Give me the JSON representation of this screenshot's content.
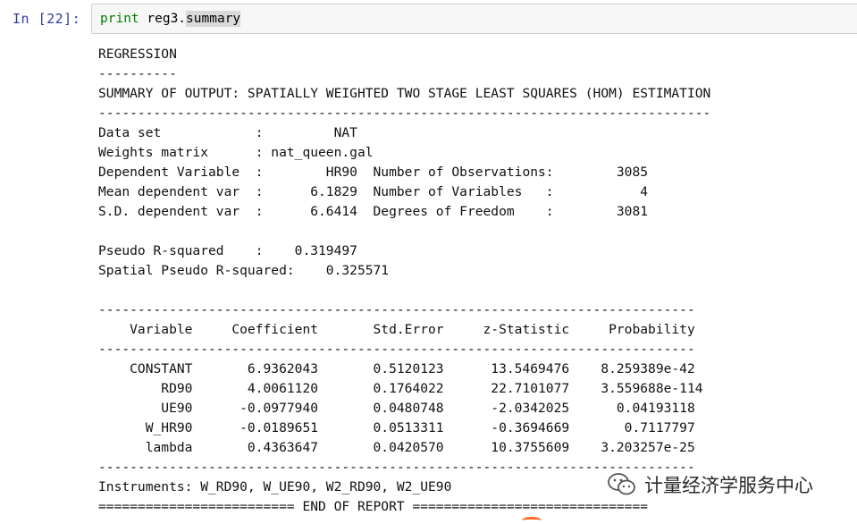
{
  "cell": {
    "prompt": "In  [22]:",
    "code_keyword": "print",
    "code_rest": " reg3.",
    "code_highlight": "summary"
  },
  "output_lines": [
    "REGRESSION",
    "----------",
    "SUMMARY OF OUTPUT: SPATIALLY WEIGHTED TWO STAGE LEAST SQUARES (HOM) ESTIMATION",
    "------------------------------------------------------------------------------",
    "Data set            :         NAT",
    "Weights matrix      : nat_queen.gal",
    "Dependent Variable  :        HR90  Number of Observations:        3085",
    "Mean dependent var  :      6.1829  Number of Variables   :           4",
    "S.D. dependent var  :      6.6414  Degrees of Freedom    :        3081",
    "",
    "Pseudo R-squared    :    0.319497",
    "Spatial Pseudo R-squared:    0.325571",
    "",
    "----------------------------------------------------------------------------",
    "    Variable     Coefficient       Std.Error     z-Statistic     Probability",
    "----------------------------------------------------------------------------",
    "    CONSTANT       6.9362043       0.5120123      13.5469476    8.259389e-42",
    "        RD90       4.0061120       0.1764022      22.7101077    3.559688e-114",
    "        UE90      -0.0977940       0.0480748      -2.0342025      0.04193118",
    "      W_HR90      -0.0189651       0.0513311      -0.3694669       0.7117797",
    "      lambda       0.4363647       0.0420570      10.3755609    3.203257e-25",
    "----------------------------------------------------------------------------",
    "Instruments: W_RD90, W_UE90, W2_RD90, W2_UE90",
    "========================= END OF REPORT =============================="
  ],
  "watermark": {
    "text": "计量经济学服务中心",
    "icon": "wechat-icon"
  }
}
